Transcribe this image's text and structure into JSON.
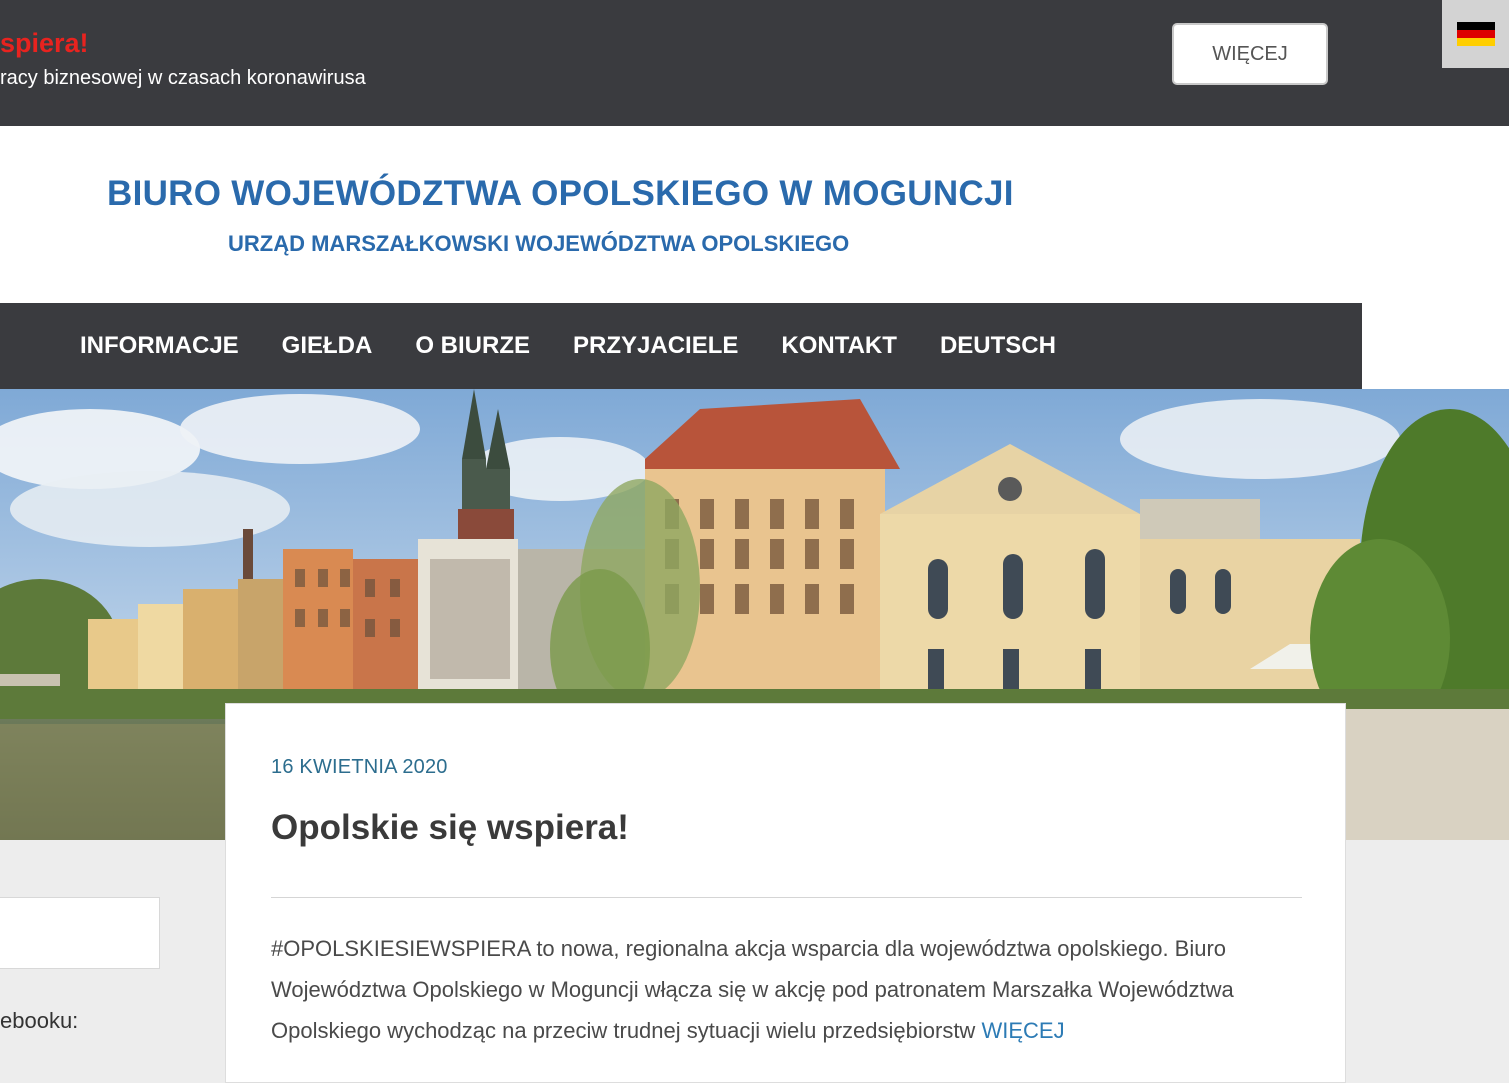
{
  "topbar": {
    "promo_title": "Opolskie się wspiera!",
    "promo_title_visible": "spiera!",
    "promo_subtitle_visible": "racy biznesowej w czasach koronawirusa",
    "more_button": "WIĘCEJ",
    "language_flag": "german-flag-icon"
  },
  "header": {
    "title": "BIURO WOJEWÓDZTWA OPOLSKIEGO W MOGUNCJI",
    "subtitle": "URZĄD MARSZAŁKOWSKI WOJEWÓDZTWA OPOLSKIEGO"
  },
  "nav": {
    "items": [
      {
        "label": "INFORMACJE"
      },
      {
        "label": "GIEŁDA"
      },
      {
        "label": "O BIURZE"
      },
      {
        "label": "PRZYJACIELE"
      },
      {
        "label": "KONTAKT"
      },
      {
        "label": "DEUTSCH"
      }
    ]
  },
  "sidebar": {
    "facebook_label_visible": "ebooku:"
  },
  "post": {
    "date": "16 KWIETNIA 2020",
    "title": "Opolskie się wspiera!",
    "body": "#OPOLSKIESIEWSPIERA to nowa, regionalna akcja wsparcia dla województwa opolskiego. Biuro Województwa Opolskiego w Moguncji włącza się w akcję pod patronatem Marszałka Województwa Opolskiego wychodząc na przeciw trudnej sytuacji wielu przedsiębiorstw",
    "more_link": "WIĘCEJ"
  },
  "colors": {
    "dark_bar": "#3a3b3f",
    "brand_blue": "#2a6aac",
    "alert_red": "#e8231f",
    "link_blue": "#2c7bb5"
  }
}
